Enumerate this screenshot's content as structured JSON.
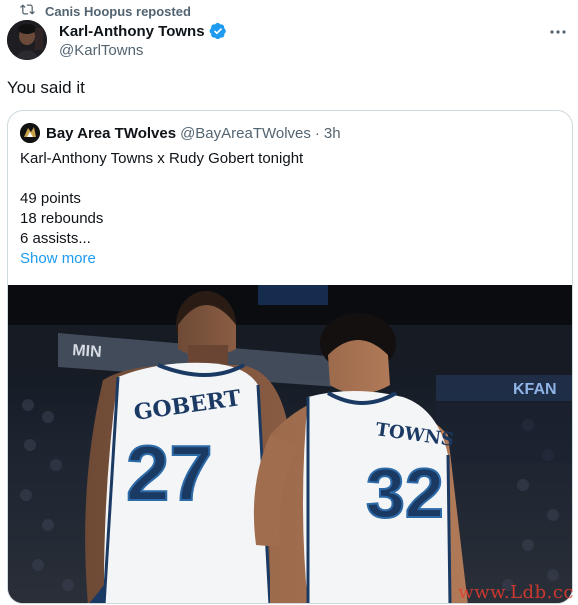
{
  "repost": {
    "text": "Canis Hoopus reposted",
    "icon": "repost-icon"
  },
  "author": {
    "display_name": "Karl-Anthony Towns",
    "handle": "@KarlTowns",
    "verified": true,
    "verified_color": "#1d9bf0"
  },
  "more_icon": "more-icon",
  "tweet": {
    "text": "You said it"
  },
  "quote": {
    "display_name": "Bay Area TWolves",
    "handle": "@BayAreaTWolves",
    "separator": "·",
    "time": "3h",
    "lines": [
      "Karl-Anthony Towns x Rudy Gobert tonight",
      "",
      "49 points",
      "18 rebounds",
      "6 assists..."
    ],
    "show_more": "Show more"
  },
  "media": {
    "jersey_left": {
      "name": "GOBERT",
      "number": "27"
    },
    "jersey_right": {
      "name": "TOWNS",
      "number": "32"
    },
    "arena_sign_left": "MIN",
    "arena_sign_right": "KFAN"
  },
  "watermark": "www.Ldb.cc",
  "colors": {
    "text_primary": "#0f1419",
    "text_secondary": "#536471",
    "link": "#1d9bf0",
    "border": "#cfd9de",
    "jersey_navy": "#1b3a63",
    "jersey_blue": "#2d6aa8"
  }
}
